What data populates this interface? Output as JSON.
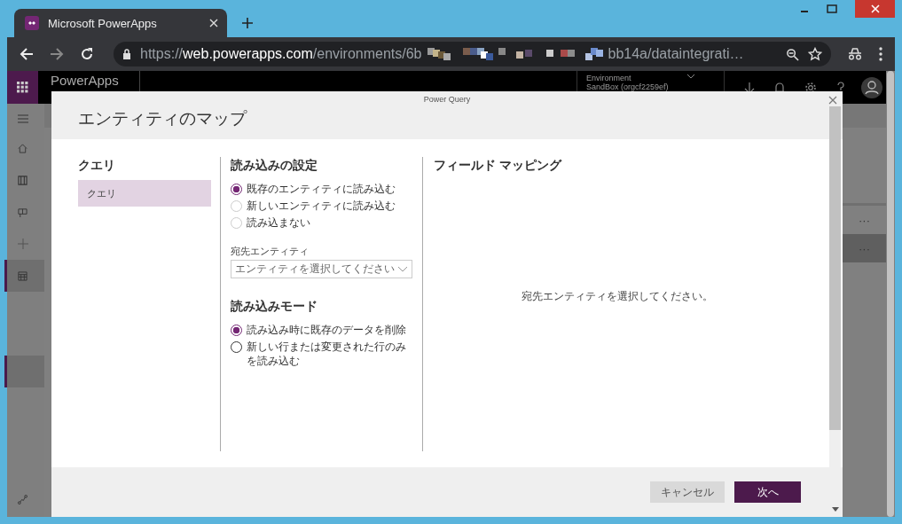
{
  "browser": {
    "tab_title": "Microsoft PowerApps",
    "url": {
      "scheme": "https://",
      "host": "web.powerapps.com",
      "path": "/environments/6b",
      "tail": "bb14a/dataintegrati…"
    }
  },
  "app_header": {
    "product": "PowerApps",
    "environment_label": "Environment",
    "environment_name": "SandBox (orgcf2259ef)"
  },
  "nav": {
    "items": [
      {
        "selected": false
      },
      {
        "selected": false
      },
      {
        "selected": false
      },
      {
        "selected": false
      },
      {
        "selected": true
      },
      {
        "selected": false
      },
      {
        "selected": false
      },
      {
        "selected": true
      },
      {
        "selected": false
      },
      {
        "selected": false
      },
      {
        "selected": false
      },
      {
        "selected": false
      }
    ]
  },
  "background_rows": [
    {
      "menu": "···",
      "selected": false
    },
    {
      "menu": "···",
      "selected": true
    }
  ],
  "dialog": {
    "caption": "Power Query",
    "title": "エンティティのマップ",
    "queries": {
      "heading": "クエリ",
      "items": [
        {
          "label": "クエリ",
          "selected": true
        }
      ]
    },
    "load_settings": {
      "heading": "読み込みの設定",
      "options": [
        {
          "label": "既存のエンティティに読み込む",
          "selected": true,
          "disabled": false
        },
        {
          "label": "新しいエンティティに読み込む",
          "selected": false,
          "disabled": true
        },
        {
          "label": "読み込まない",
          "selected": false,
          "disabled": true
        }
      ],
      "target_label": "宛先エンティティ",
      "target_placeholder": "エンティティを選択してください"
    },
    "load_mode": {
      "heading": "読み込みモード",
      "options": [
        {
          "label": "読み込み時に既存のデータを削除",
          "selected": true,
          "disabled": false
        },
        {
          "label": "新しい行または変更された行のみを読み込む",
          "selected": false,
          "disabled": false
        }
      ]
    },
    "field_mapping": {
      "heading": "フィールド マッピング",
      "empty_message": "宛先エンティティを選択してください。"
    },
    "buttons": [
      {
        "kind": "secondary",
        "label": "キャンセル"
      },
      {
        "kind": "primary",
        "label": "次へ"
      }
    ]
  }
}
